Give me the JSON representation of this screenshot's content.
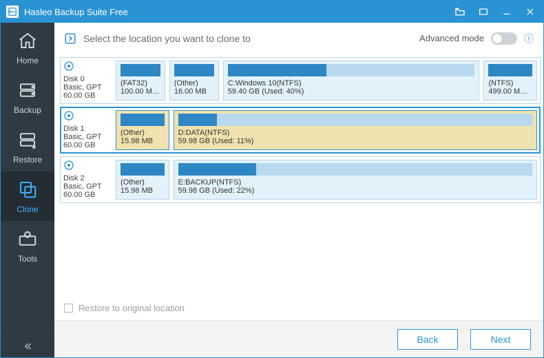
{
  "app": {
    "title": "Hasleo Backup Suite Free"
  },
  "sidebar": {
    "items": [
      {
        "label": "Home"
      },
      {
        "label": "Backup"
      },
      {
        "label": "Restore"
      },
      {
        "label": "Clone"
      },
      {
        "label": "Tools"
      }
    ],
    "active_index": 3
  },
  "instruction": "Select the location you want to clone to",
  "advanced_mode": {
    "label": "Advanced mode",
    "on": false
  },
  "disks": [
    {
      "name": "Disk 0",
      "scheme": "Basic, GPT",
      "size": "60.00 GB",
      "selected": false,
      "partitions": [
        {
          "label": "(FAT32)",
          "sub": "100.00 MB ...",
          "used_pct": 100,
          "flex": 10
        },
        {
          "label": "(Other)",
          "sub": "16.00 MB",
          "used_pct": 100,
          "flex": 10
        },
        {
          "label": "C:Windows 10(NTFS)",
          "sub": "59.40 GB (Used: 40%)",
          "used_pct": 40,
          "flex": 62
        },
        {
          "label": "(NTFS)",
          "sub": "499.00 MB ...",
          "used_pct": 100,
          "flex": 11
        }
      ]
    },
    {
      "name": "Disk 1",
      "scheme": "Basic, GPT",
      "size": "60.00 GB",
      "selected": true,
      "partitions": [
        {
          "label": "(Other)",
          "sub": "15.98 MB",
          "used_pct": 100,
          "flex": 11
        },
        {
          "label": "D:DATA(NTFS)",
          "sub": "59.98 GB (Used: 11%)",
          "used_pct": 11,
          "flex": 89
        }
      ]
    },
    {
      "name": "Disk 2",
      "scheme": "Basic, GPT",
      "size": "60.00 GB",
      "selected": false,
      "partitions": [
        {
          "label": "(Other)",
          "sub": "15.98 MB",
          "used_pct": 100,
          "flex": 11
        },
        {
          "label": "E:BACKUP(NTFS)",
          "sub": "59.98 GB (Used: 22%)",
          "used_pct": 22,
          "flex": 89
        }
      ]
    }
  ],
  "restore_checkbox": {
    "label": "Restore to original location",
    "checked": false
  },
  "buttons": {
    "back": "Back",
    "next": "Next"
  }
}
